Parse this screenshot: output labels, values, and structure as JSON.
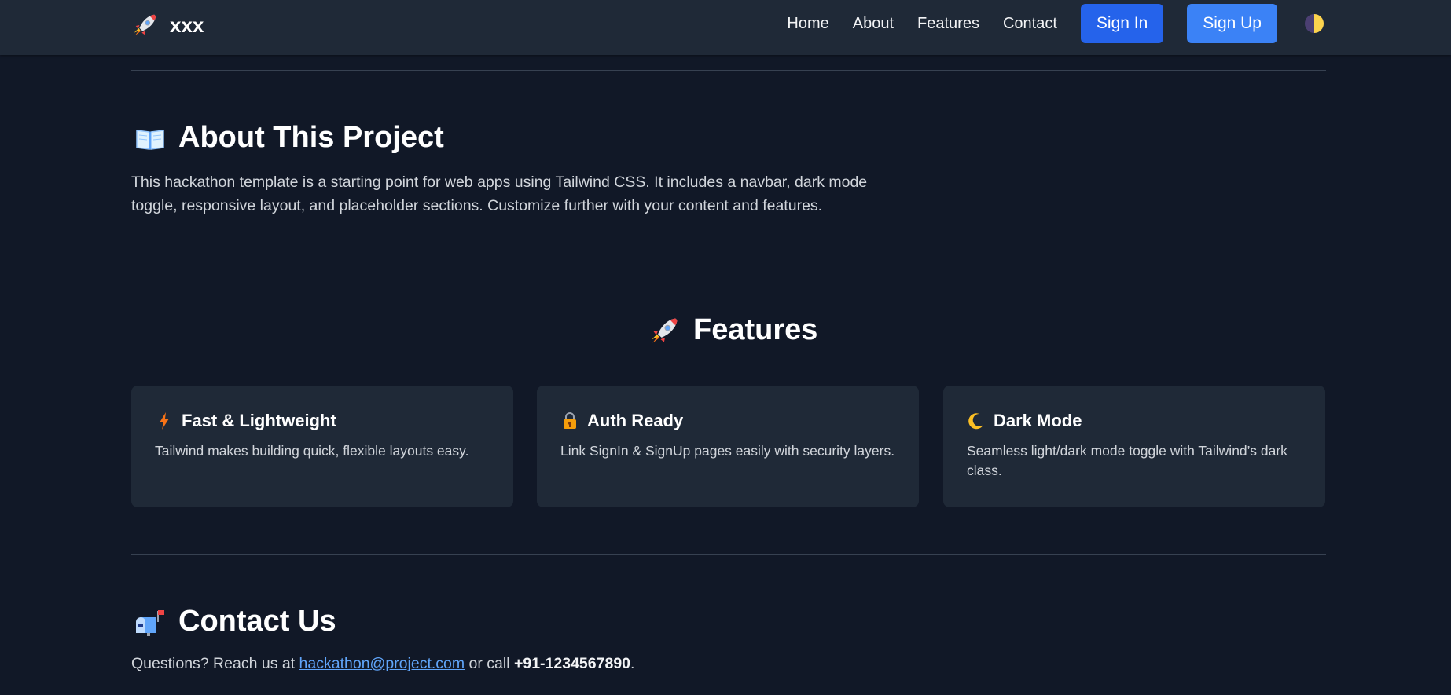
{
  "navbar": {
    "brand": "xxx",
    "brand_icon": "rocket-icon",
    "links": [
      "Home",
      "About",
      "Features",
      "Contact"
    ],
    "signin_label": "Sign In",
    "signup_label": "Sign Up",
    "theme_icon": "half-moon-icon"
  },
  "about": {
    "icon": "open-book-icon",
    "title": "About This Project",
    "text": "This hackathon template is a starting point for web apps using Tailwind CSS. It includes a navbar, dark mode toggle, responsive layout, and placeholder sections. Customize further with your content and features."
  },
  "features": {
    "icon": "rocket-icon",
    "title": "Features",
    "cards": [
      {
        "icon": "lightning-icon",
        "title": "Fast & Lightweight",
        "desc": "Tailwind makes building quick, flexible layouts easy."
      },
      {
        "icon": "lock-key-icon",
        "title": "Auth Ready",
        "desc": "Link SignIn & SignUp pages easily with security layers."
      },
      {
        "icon": "crescent-moon-icon",
        "title": "Dark Mode",
        "desc": "Seamless light/dark mode toggle with Tailwind’s dark class."
      }
    ]
  },
  "contact": {
    "icon": "mailbox-icon",
    "title": "Contact Us",
    "prefix": "Questions? Reach us at ",
    "email": "hackathon@project.com",
    "middle": " or call ",
    "phone": "+91-1234567890",
    "suffix": "."
  },
  "colors": {
    "background": "#111827",
    "navbar": "#1f2937",
    "card": "#1f2937",
    "primary_button": "#2563eb",
    "secondary_button": "#3b82f6",
    "link": "#60a5fa"
  }
}
